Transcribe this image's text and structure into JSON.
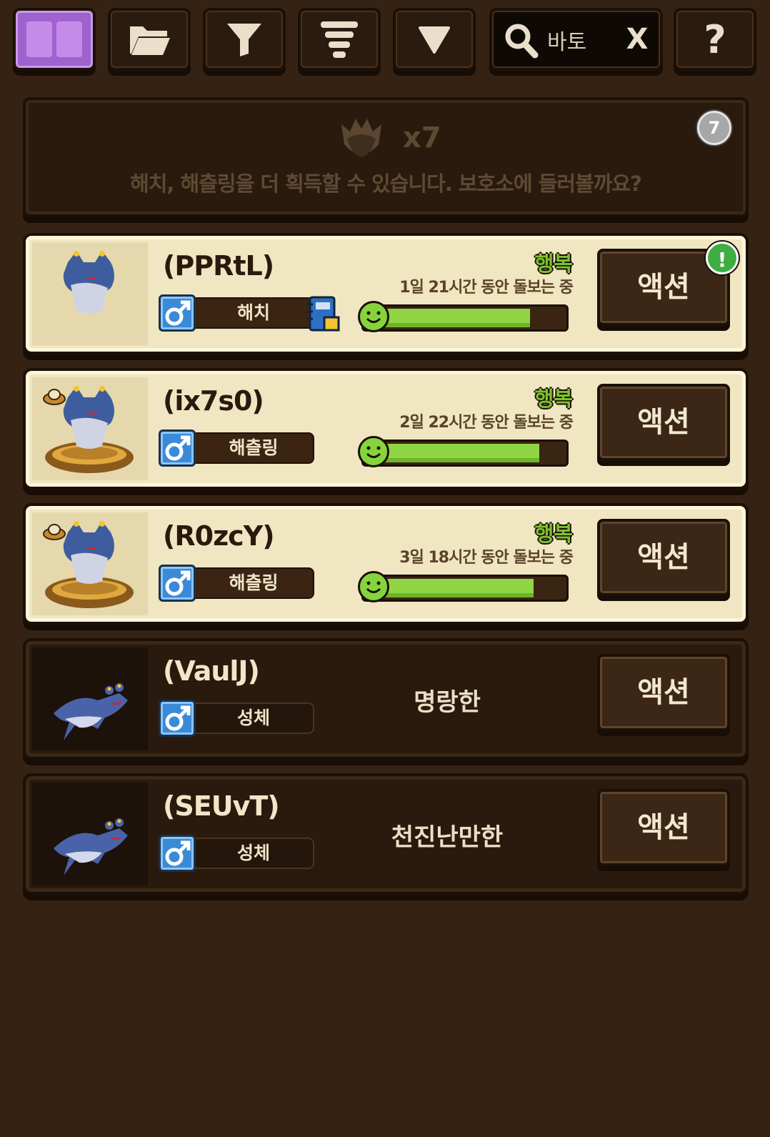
{
  "toolbar": {
    "buttons": [
      {
        "name": "view-toggle",
        "icon": "grid-icon"
      },
      {
        "name": "folder",
        "icon": "folder-icon"
      },
      {
        "name": "filter",
        "icon": "filter-icon"
      },
      {
        "name": "sort",
        "icon": "sort-icon"
      },
      {
        "name": "dropdown",
        "icon": "triangle-down-icon"
      },
      {
        "name": "help",
        "icon": "question-icon",
        "label": "?"
      }
    ],
    "search": {
      "value": "바토",
      "clear_label": "X"
    }
  },
  "egg_banner": {
    "count": "x7",
    "message": "해치, 해츨링을 더 획득할 수 있습니다. 보호소에 들러볼까요?",
    "badge": "7"
  },
  "pets": [
    {
      "name": "(PPRtL)",
      "gender": "male",
      "stage": "해치",
      "mood": "행복",
      "care": "1일 21시간 동안 돌보는 중",
      "happiness": 0.82,
      "action": "액션",
      "alert": "!",
      "has_note": true,
      "style": "light"
    },
    {
      "name": "(ix7s0)",
      "gender": "male",
      "stage": "해츨링",
      "mood": "행복",
      "care": "2일 22시간 동안 돌보는 중",
      "happiness": 0.87,
      "action": "액션",
      "style": "light",
      "nest": true
    },
    {
      "name": "(R0zcY)",
      "gender": "male",
      "stage": "해츨링",
      "mood": "행복",
      "care": "3일 18시간 동안 돌보는 중",
      "happiness": 0.84,
      "action": "액션",
      "style": "light",
      "nest": true
    },
    {
      "name": "(VaulJ)",
      "gender": "male",
      "stage": "성체",
      "trait": "명랑한",
      "action": "액션",
      "style": "dark"
    },
    {
      "name": "(SEUvT)",
      "gender": "male",
      "stage": "성체",
      "trait": "천진난만한",
      "action": "액션",
      "style": "dark"
    }
  ],
  "colors": {
    "background": "#352213",
    "accent_active": "#a062cf",
    "happiness_green": "#90d644",
    "mood_text": "#7cc22e"
  }
}
